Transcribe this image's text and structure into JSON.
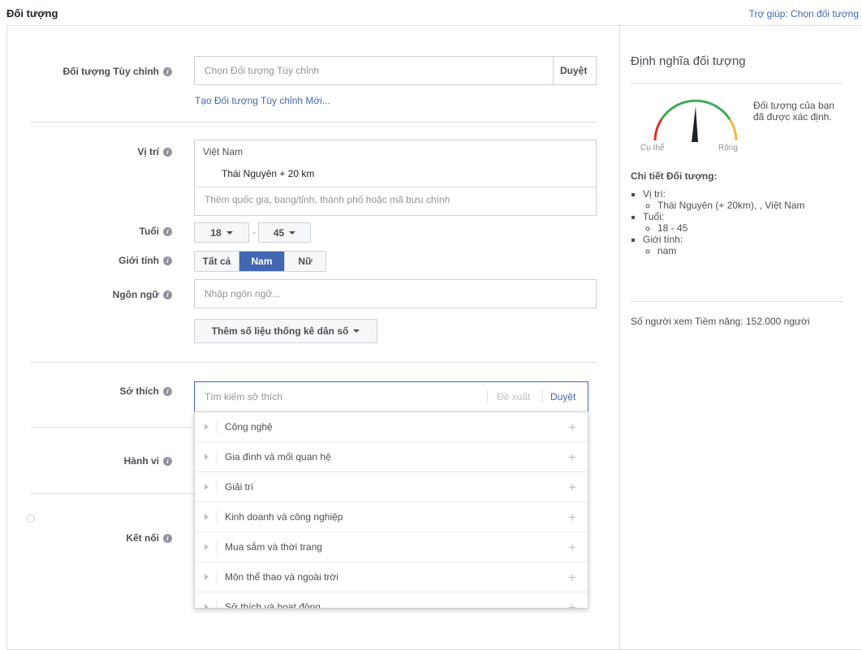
{
  "header": {
    "title": "Đối tượng",
    "help_link": "Trợ giúp: Chọn đối tượng"
  },
  "custom_audience": {
    "label": "Đối tượng Tùy chỉnh",
    "placeholder": "Chọn Đối tượng Tùy chỉnh",
    "browse": "Duyệt",
    "create_link": "Tạo Đối tượng Tùy chỉnh Mới..."
  },
  "location": {
    "label": "Vị trí",
    "country": "Việt Nam",
    "city": "Thái Nguyên + 20 km",
    "placeholder": "Thêm quốc gia, bang/tỉnh, thành phố hoặc mã bưu chính"
  },
  "age": {
    "label": "Tuổi",
    "min": "18",
    "max": "45",
    "separator": "-"
  },
  "gender": {
    "label": "Giới tính",
    "options": [
      "Tất cả",
      "Nam",
      "Nữ"
    ],
    "selected": "Nam"
  },
  "language": {
    "label": "Ngôn ngữ",
    "placeholder": "Nhập ngôn ngữ..."
  },
  "demographics_button": "Thêm số liệu thống kê dân số",
  "interests": {
    "label": "Sở thích",
    "placeholder": "Tìm kiếm sở thích",
    "suggest": "Đề xuất",
    "browse": "Duyệt",
    "categories": [
      "Công nghệ",
      "Gia đình và mối quan hệ",
      "Giải trí",
      "Kinh doanh và công nghiệp",
      "Mua sắm và thời trang",
      "Môn thể thao và ngoài trời",
      "Sở thích và hoạt động"
    ]
  },
  "behaviors": {
    "label": "Hành vi"
  },
  "connections": {
    "label": "Kết nối"
  },
  "audience_definition": {
    "title": "Định nghĩa đối tượng",
    "gauge_text": "Đối tượng của bạn đã được xác định.",
    "specific": "Cụ thể",
    "broad": "Rộng",
    "details_title": "Chi tiết Đối tượng:",
    "location_label": "Vị trí:",
    "location_value": "Thái Nguyên (+ 20km), , Việt Nam",
    "age_label": "Tuổi:",
    "age_value": "18 - 45",
    "gender_label": "Giới tính:",
    "gender_value": "nam",
    "reach": "Số người xem Tiềm năng: 152.000 người"
  },
  "colors": {
    "accent": "#4267b2",
    "gauge_red": "#e2312a",
    "gauge_green": "#42a85a",
    "gauge_orange": "#f5b34b"
  }
}
